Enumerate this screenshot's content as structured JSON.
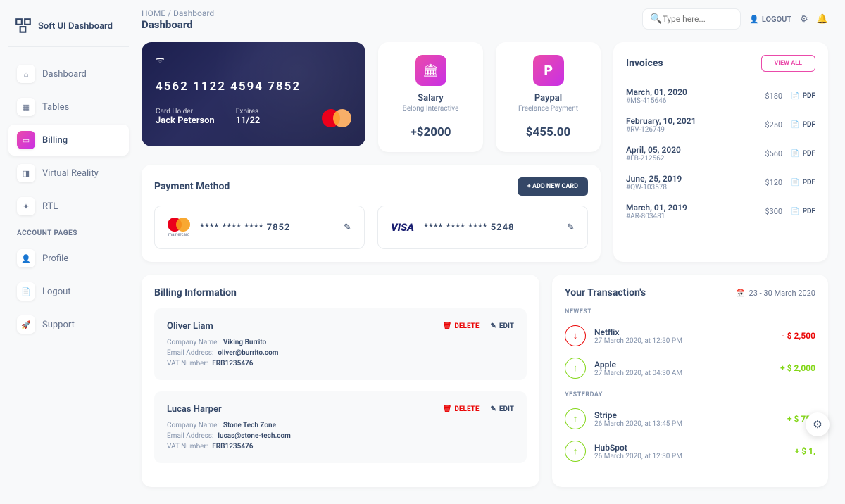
{
  "brand": "Soft UI Dashboard",
  "nav": {
    "items": [
      "Dashboard",
      "Tables",
      "Billing",
      "Virtual Reality",
      "RTL"
    ],
    "section": "ACCOUNT PAGES",
    "account_items": [
      "Profile",
      "Logout",
      "Support"
    ]
  },
  "breadcrumb": {
    "home": "HOME",
    "sep": "/",
    "current": "Dashboard"
  },
  "page_title": "Dashboard",
  "search": {
    "placeholder": "Type here..."
  },
  "topbar": {
    "logout": "LOGOUT"
  },
  "card": {
    "number": "4562  1122  4594  7852",
    "holder_label": "Card Holder",
    "holder": "Jack Peterson",
    "exp_label": "Expires",
    "exp": "11/22"
  },
  "stats": [
    {
      "title": "Salary",
      "sub": "Belong Interactive",
      "val": "+$2000"
    },
    {
      "title": "Paypal",
      "sub": "Freelance Payment",
      "val": "$455.00"
    }
  ],
  "invoices": {
    "title": "Invoices",
    "view_all": "VIEW ALL",
    "pdf": "PDF",
    "rows": [
      {
        "date": "March, 01, 2020",
        "id": "#MS-415646",
        "amt": "$180"
      },
      {
        "date": "February, 10, 2021",
        "id": "#RV-126749",
        "amt": "$250"
      },
      {
        "date": "April, 05, 2020",
        "id": "#FB-212562",
        "amt": "$560"
      },
      {
        "date": "June, 25, 2019",
        "id": "#QW-103578",
        "amt": "$120"
      },
      {
        "date": "March, 01, 2019",
        "id": "#AR-803481",
        "amt": "$300"
      }
    ]
  },
  "payment": {
    "title": "Payment Method",
    "add": "ADD NEW CARD",
    "methods": [
      {
        "brand": "mastercard",
        "num": "****  ****  ****  7852"
      },
      {
        "brand": "visa",
        "num": "****  ****  ****  5248"
      }
    ]
  },
  "billing": {
    "title": "Billing Information",
    "delete": "DELETE",
    "edit": "EDIT",
    "labels": {
      "company": "Company Name:",
      "email": "Email Address:",
      "vat": "VAT Number:"
    },
    "items": [
      {
        "name": "Oliver Liam",
        "company": "Viking Burrito",
        "email": "oliver@burrito.com",
        "vat": "FRB1235476"
      },
      {
        "name": "Lucas Harper",
        "company": "Stone Tech Zone",
        "email": "lucas@stone-tech.com",
        "vat": "FRB1235476"
      }
    ]
  },
  "trans": {
    "title": "Your Transaction's",
    "range": "23 - 30 March 2020",
    "sec1": "NEWEST",
    "sec2": "YESTERDAY",
    "newest": [
      {
        "name": "Netflix",
        "date": "27 March 2020, at 12:30 PM",
        "amt": "- $ 2,500",
        "dir": "down"
      },
      {
        "name": "Apple",
        "date": "27 March 2020, at 04:30 AM",
        "amt": "+ $ 2,000",
        "dir": "up"
      }
    ],
    "yesterday": [
      {
        "name": "Stripe",
        "date": "26 March 2020, at 13:45 PM",
        "amt": "+ $ 750",
        "dir": "up"
      },
      {
        "name": "HubSpot",
        "date": "26 March 2020, at 12:30 PM",
        "amt": "+ $ 1,",
        "dir": "up"
      }
    ]
  }
}
